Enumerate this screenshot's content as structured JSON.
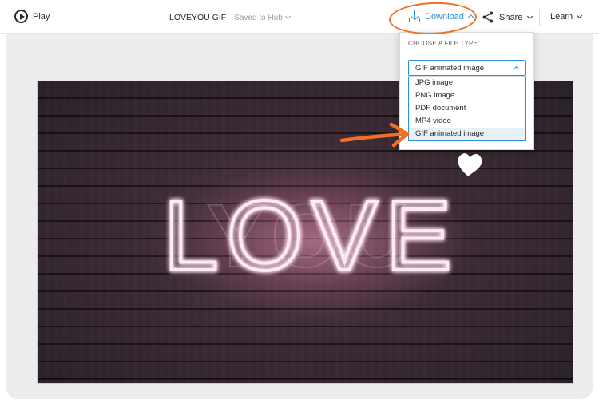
{
  "toolbar": {
    "play_label": "Play",
    "title": "LOVEYOU GIF",
    "saved_status": "Saved to Hub",
    "download_label": "Download",
    "share_label": "Share",
    "learn_label": "Learn"
  },
  "download_menu": {
    "header": "CHOOSE A FILE TYPE:",
    "selected": "GIF animated image",
    "options": [
      "JPG image",
      "PNG image",
      "PDF document",
      "MP4 video",
      "GIF animated image"
    ],
    "highlighted_index": 4
  },
  "artwork": {
    "neon_text": "LOVE",
    "ghost_text": "YOU"
  },
  "colors": {
    "accent": "#2f8fd6",
    "annotation": "#f07126",
    "neon": "#ffe9f2"
  },
  "icons": [
    "play-icon",
    "download-icon",
    "share-icon",
    "chevron-down-icon",
    "chevron-up-icon",
    "heart-icon",
    "arrow-icon"
  ]
}
